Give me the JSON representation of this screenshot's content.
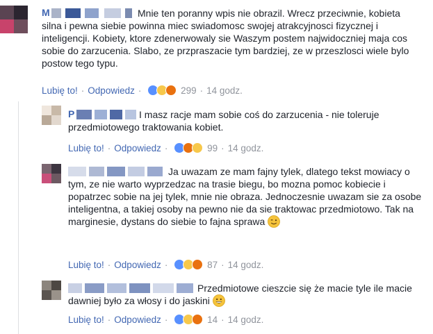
{
  "reply_label": "Odpowiedz",
  "like_label": "Lubię to!",
  "comments": [
    {
      "author_visible": "M",
      "text": "Mnie ten poranny wpis nie obrazil. Wrecz przeciwnie, kobieta silna i pewna siebie powinna miec swiadomosc swojej atrakcyjnosci fizycznej i inteligencji. Kobiety, ktore zdenerwowaly sie Waszym postem najwidoczniej maja cos sobie do zarzucenia. Slabo, ze przpraszacie tym bardziej, ze w przeszlosci wiele bylo postow tego typu.",
      "reaction_count": "299",
      "time": "14 godz.",
      "reactions": [
        "like",
        "haha",
        "angry"
      ]
    },
    {
      "author_visible": "P",
      "text": "I masz racje mam sobie coś do zarzucenia - nie toleruje przedmiotowego traktowania kobiet.",
      "reaction_count": "99",
      "time": "14 godz.",
      "reactions": [
        "like",
        "angry",
        "haha"
      ]
    },
    {
      "author_visible": "",
      "text": "Ja uwazam ze mam fajny tylek, dlatego tekst mowiacy o tym, ze nie warto wyprzedzac na trasie biegu, bo mozna pomoc kobiecie i popatrzec sobie na jej tylek, mnie nie obraza. Jednoczesnie uwazam sie za osobe inteligentna, a takiej osoby na pewno nie da sie traktowac przedmiotowo. Tak na marginesie, dystans do siebie to fajna sprawa",
      "emoji": "wink-emoji",
      "reaction_count": "87",
      "time": "14 godz.",
      "reactions": [
        "like",
        "haha",
        "angry"
      ]
    },
    {
      "author_visible": "",
      "text": "Przedmiotowe cieszcie się że macie tyle ile macie dawniej było za włosy i do jaskini",
      "emoji": "grin-emoji",
      "reaction_count": "14",
      "time": "14 godz.",
      "reactions": [
        "like",
        "haha",
        "angry"
      ]
    }
  ],
  "colors": {
    "link": "#4267b2",
    "meta_gray": "#90949c",
    "text": "#1d2129",
    "like": "#5890ff",
    "haha": "#f7c84b",
    "angry": "#e9710f"
  }
}
